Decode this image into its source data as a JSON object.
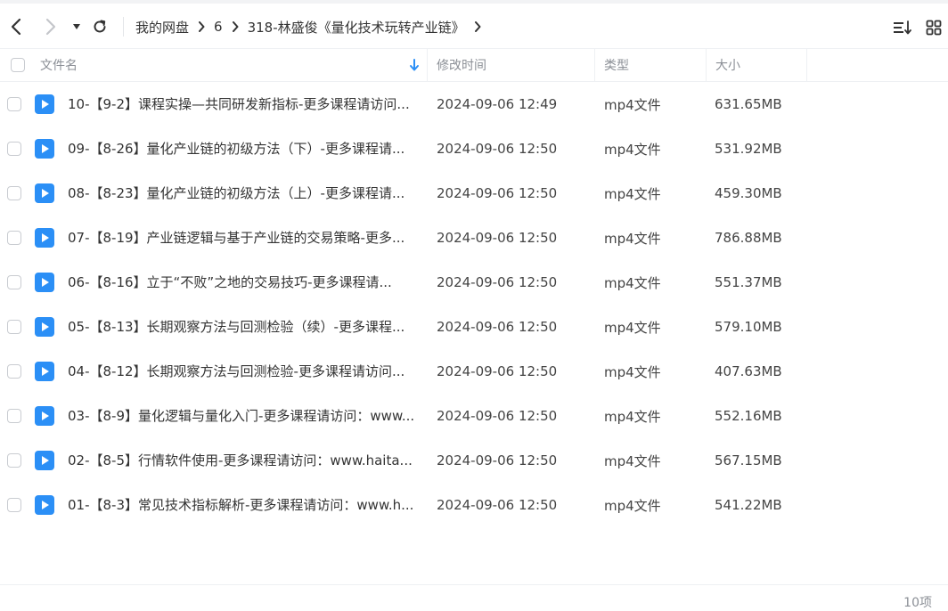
{
  "breadcrumb": [
    "我的网盘",
    "6",
    "318-林盛俊《量化技术玩转产业链》"
  ],
  "columns": {
    "name": "文件名",
    "modified": "修改时间",
    "type": "类型",
    "size": "大小"
  },
  "files": [
    {
      "name": "10-【9-2】课程实操—共同研发新指标-更多课程请访问...",
      "modified": "2024-09-06 12:49",
      "type": "mp4文件",
      "size": "631.65MB"
    },
    {
      "name": "09-【8-26】量化产业链的初级方法（下）-更多课程请...",
      "modified": "2024-09-06 12:50",
      "type": "mp4文件",
      "size": "531.92MB"
    },
    {
      "name": "08-【8-23】量化产业链的初级方法（上）-更多课程请...",
      "modified": "2024-09-06 12:50",
      "type": "mp4文件",
      "size": "459.30MB"
    },
    {
      "name": "07-【8-19】产业链逻辑与基于产业链的交易策略-更多...",
      "modified": "2024-09-06 12:50",
      "type": "mp4文件",
      "size": "786.88MB"
    },
    {
      "name": "06-【8-16】立于“不败”之地的交易技巧-更多课程请...",
      "modified": "2024-09-06 12:50",
      "type": "mp4文件",
      "size": "551.37MB"
    },
    {
      "name": "05-【8-13】长期观察方法与回测检验（续）-更多课程...",
      "modified": "2024-09-06 12:50",
      "type": "mp4文件",
      "size": "579.10MB"
    },
    {
      "name": "04-【8-12】长期观察方法与回测检验-更多课程请访问...",
      "modified": "2024-09-06 12:50",
      "type": "mp4文件",
      "size": "407.63MB"
    },
    {
      "name": "03-【8-9】量化逻辑与量化入门-更多课程请访问：www...",
      "modified": "2024-09-06 12:50",
      "type": "mp4文件",
      "size": "552.16MB"
    },
    {
      "name": "02-【8-5】行情软件使用-更多课程请访问：www.haita...",
      "modified": "2024-09-06 12:50",
      "type": "mp4文件",
      "size": "567.15MB"
    },
    {
      "name": "01-【8-3】常见技术指标解析-更多课程请访问：www.h...",
      "modified": "2024-09-06 12:50",
      "type": "mp4文件",
      "size": "541.22MB"
    }
  ],
  "footer": {
    "count": "10项"
  },
  "colors": {
    "accent": "#2b8ff6",
    "icon": "#2b8ff6",
    "text": "#333333",
    "muted": "#8b8f96"
  },
  "icons": {
    "back": "chevron-left-icon",
    "forward": "chevron-right-icon",
    "history": "caret-down-icon",
    "refresh": "refresh-icon",
    "sort": "sort-icon",
    "grid": "grid-view-icon",
    "file": "video-file-icon"
  }
}
